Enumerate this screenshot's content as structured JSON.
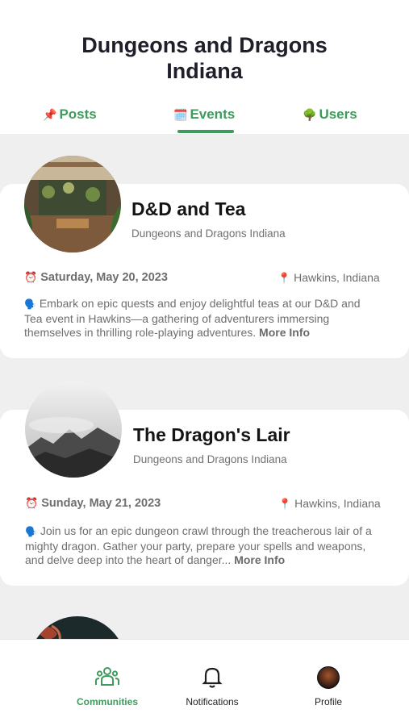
{
  "header": {
    "title": "Dungeons and Dragons Indiana"
  },
  "tabs": [
    {
      "label": "Posts",
      "icon": "pushpin-icon",
      "active": false
    },
    {
      "label": "Events",
      "icon": "calendar-icon",
      "active": true
    },
    {
      "label": "Users",
      "icon": "tree-icon",
      "active": false
    }
  ],
  "events": [
    {
      "title": "D&D and Tea",
      "group": "Dungeons and Dragons Indiana",
      "date": "Saturday, May 20, 2023",
      "location": "Hawkins, Indiana",
      "description": "Embark on epic quests and enjoy delightful teas at our D&D and Tea event in Hawkins—a gathering of adventurers immersing themselves in thrilling role-playing adventures.",
      "more_label": "More Info"
    },
    {
      "title": "The Dragon's Lair",
      "group": "Dungeons and Dragons Indiana",
      "date": "Sunday, May 21, 2023",
      "location": "Hawkins, Indiana",
      "description": "Join us for an epic dungeon crawl through the treacherous lair of a mighty dragon. Gather your party, prepare your spells and weapons, and delve deep into the heart of danger...",
      "more_label": "More Info"
    }
  ],
  "fab": {
    "icon": "plus-icon"
  },
  "bottom_nav": [
    {
      "label": "Communities",
      "icon": "communities-icon",
      "active": true
    },
    {
      "label": "Notifications",
      "icon": "bell-icon",
      "active": false
    },
    {
      "label": "Profile",
      "icon": "avatar",
      "active": false
    }
  ],
  "colors": {
    "accent": "#3f9a5d",
    "feed_background": "#efefef",
    "fab": "#1f1f1f"
  }
}
